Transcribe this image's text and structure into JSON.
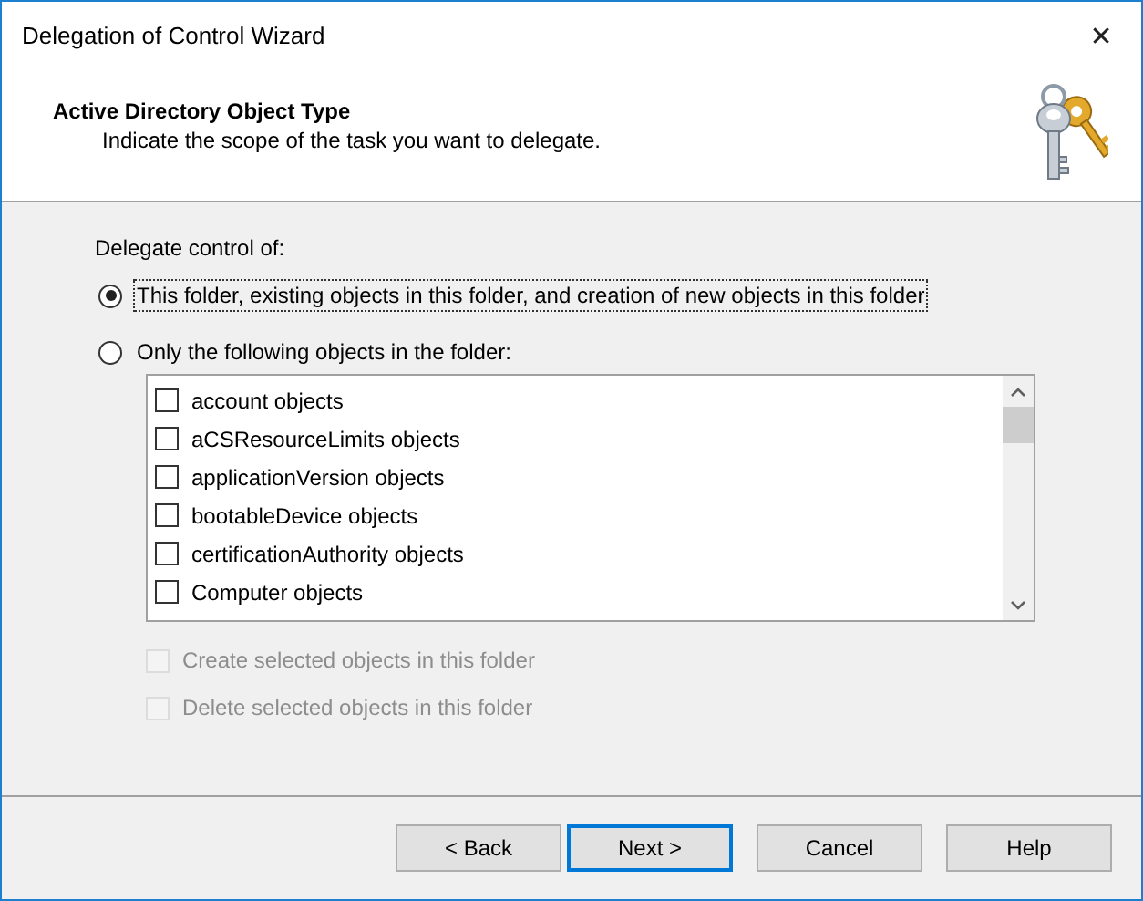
{
  "window": {
    "title": "Delegation of Control Wizard",
    "close": "✕"
  },
  "header": {
    "title": "Active Directory Object Type",
    "subtitle": "Indicate the scope of the task you want to delegate."
  },
  "group_label": "Delegate control of:",
  "radios": [
    {
      "label": "This folder, existing objects in this folder, and creation of new objects in this folder",
      "selected": true,
      "focused": true
    },
    {
      "label": "Only the following objects in the folder:",
      "selected": false,
      "focused": false
    }
  ],
  "object_list": {
    "items": [
      {
        "label": "account objects",
        "checked": false
      },
      {
        "label": "aCSResourceLimits objects",
        "checked": false
      },
      {
        "label": "applicationVersion objects",
        "checked": false
      },
      {
        "label": "bootableDevice objects",
        "checked": false
      },
      {
        "label": "certificationAuthority objects",
        "checked": false
      },
      {
        "label": "Computer objects",
        "checked": false
      }
    ]
  },
  "options": [
    {
      "label": "Create selected objects in this folder",
      "checked": false,
      "disabled": true
    },
    {
      "label": "Delete selected objects in this folder",
      "checked": false,
      "disabled": true
    }
  ],
  "buttons": [
    {
      "label": "< Back",
      "default": false
    },
    {
      "label": "Next >",
      "default": true
    },
    {
      "label": "Cancel",
      "default": false
    },
    {
      "label": "Help",
      "default": false
    }
  ]
}
